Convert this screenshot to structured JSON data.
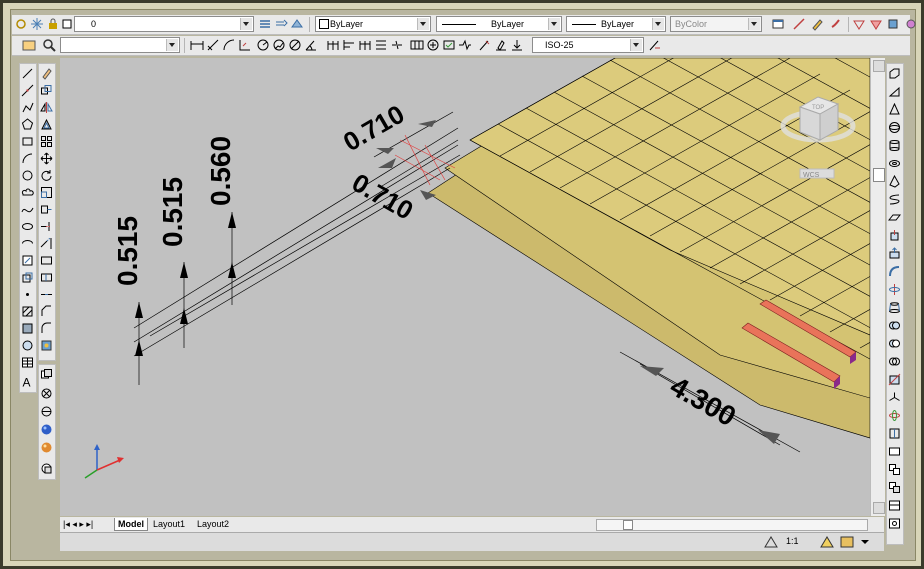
{
  "toolbar_top": {
    "layer_value": "0",
    "color_combo": "ByLayer",
    "linetype_combo": "ByLayer",
    "lineweight_combo": "ByLayer",
    "plotstyle_combo": "ByColor"
  },
  "toolbar_dim": {
    "dimstyle_value": "ISO-25"
  },
  "viewcube": {
    "face_label": "TOP",
    "wcs_label": "WCS"
  },
  "dimensions": {
    "d1": "0.515",
    "d2": "0.515",
    "d3": "0.560",
    "d4": "0.710",
    "d5": "0.710",
    "d6": "4.300"
  },
  "layout_tabs": [
    "Model",
    "Layout1",
    "Layout2"
  ],
  "status": {
    "annotation_scale": "1:1"
  },
  "colors": {
    "slab_fill": "#d9c87a",
    "highlight": "#e9735a",
    "canvas_bg": "#c1c1c1",
    "frame": "#d8d5b8"
  }
}
